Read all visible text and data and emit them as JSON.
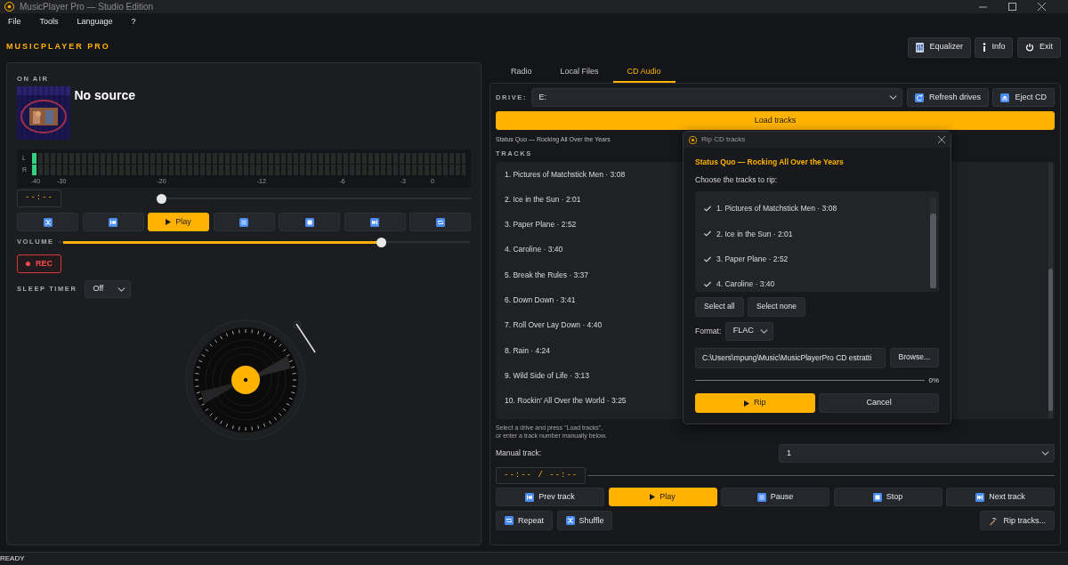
{
  "window": {
    "title": "MusicPlayer Pro — Studio Edition"
  },
  "menu": [
    "File",
    "Tools",
    "Language",
    "?"
  ],
  "brand": "MUSICPLAYER PRO",
  "header_buttons": [
    {
      "label": "Equalizer"
    },
    {
      "label": "Info"
    },
    {
      "label": "Exit"
    }
  ],
  "player": {
    "section_label": "ON AIR",
    "source": "No source",
    "meter": {
      "channels": [
        {
          "label": "L",
          "level": 0.01
        },
        {
          "label": "R",
          "level": 0.01
        }
      ],
      "scale": [
        "-40",
        "-30",
        "-20",
        "-12",
        "-6",
        "-3",
        "0"
      ]
    },
    "time": "--:--",
    "seek": {
      "level": 0
    },
    "transport": [
      {
        "kind": "icon"
      },
      {
        "kind": "icon"
      },
      {
        "kind": "primary",
        "label": "Play"
      },
      {
        "kind": "icon"
      },
      {
        "kind": "icon"
      },
      {
        "kind": "icon"
      },
      {
        "kind": "icon"
      }
    ],
    "volume": {
      "label": "VOLUME",
      "level": 0.79
    },
    "rec": {
      "label": "REC"
    },
    "sleep_timer": {
      "label": "SLEEP TIMER",
      "value": "Off"
    }
  },
  "tabs": [
    {
      "label": "Radio",
      "selected": false
    },
    {
      "label": "Local Files",
      "selected": false
    },
    {
      "label": "CD Audio",
      "selected": true
    }
  ],
  "cd": {
    "drive_label": "DRIVE:",
    "drive": "E:",
    "buttons": [
      {
        "label": "Refresh drives"
      },
      {
        "label": "Eject CD"
      }
    ],
    "load_button": "Load tracks",
    "album": "Status Quo — Rocking All Over the Years",
    "tracks_label": "TRACKS",
    "tracks": [
      "1. Pictures of Matchstick Men · 3:08",
      "2. Ice in the Sun · 2:01",
      "3. Paper Plane · 2:52",
      "4. Caroline · 3:40",
      "5. Break the Rules · 3:37",
      "6. Down Down · 3:41",
      "7. Roll Over Lay Down · 4:40",
      "8. Rain · 4:24",
      "9. Wild Side of Life · 3:13",
      "10. Rockin' All Over the World · 3:25"
    ],
    "hint": "Select a drive and press \"Load tracks\",\nor enter a track number manually below.",
    "manual_track": {
      "label": "Manual track:",
      "value": "1"
    },
    "time": "--:-- / --:--",
    "transport": [
      {
        "kind": "plain",
        "label": "Prev track"
      },
      {
        "kind": "primary",
        "label": "Play"
      },
      {
        "kind": "plain",
        "label": "Pause"
      },
      {
        "kind": "plain",
        "label": "Stop"
      },
      {
        "kind": "plain",
        "label": "Next track"
      }
    ],
    "extra_buttons": [
      {
        "label": "Repeat"
      },
      {
        "label": "Shuffle"
      },
      {
        "label": "Rip tracks..."
      }
    ]
  },
  "dialog": {
    "title": "Rip CD tracks",
    "album": "Status Quo — Rocking All Over the Years",
    "prompt": "Choose the tracks to rip:",
    "tracks": [
      {
        "label": "1. Pictures of Matchstick Men · 3:08",
        "checked": true
      },
      {
        "label": "2. Ice in the Sun · 2:01",
        "checked": true
      },
      {
        "label": "3. Paper Plane · 2:52",
        "checked": true
      },
      {
        "label": "4. Caroline · 3:40",
        "checked": true
      }
    ],
    "select_buttons": [
      "Select all",
      "Select none"
    ],
    "format_label": "Format:",
    "format": "FLAC",
    "path": "C:\\Users\\mpung\\Music\\MusicPlayerPro CD estratti",
    "browse": "Browse...",
    "progress": {
      "level": 0,
      "reading": "0%"
    },
    "actions": [
      {
        "kind": "primary",
        "label": "Rip"
      },
      {
        "kind": "plain",
        "label": "Cancel"
      }
    ]
  },
  "status_bar": "READY"
}
